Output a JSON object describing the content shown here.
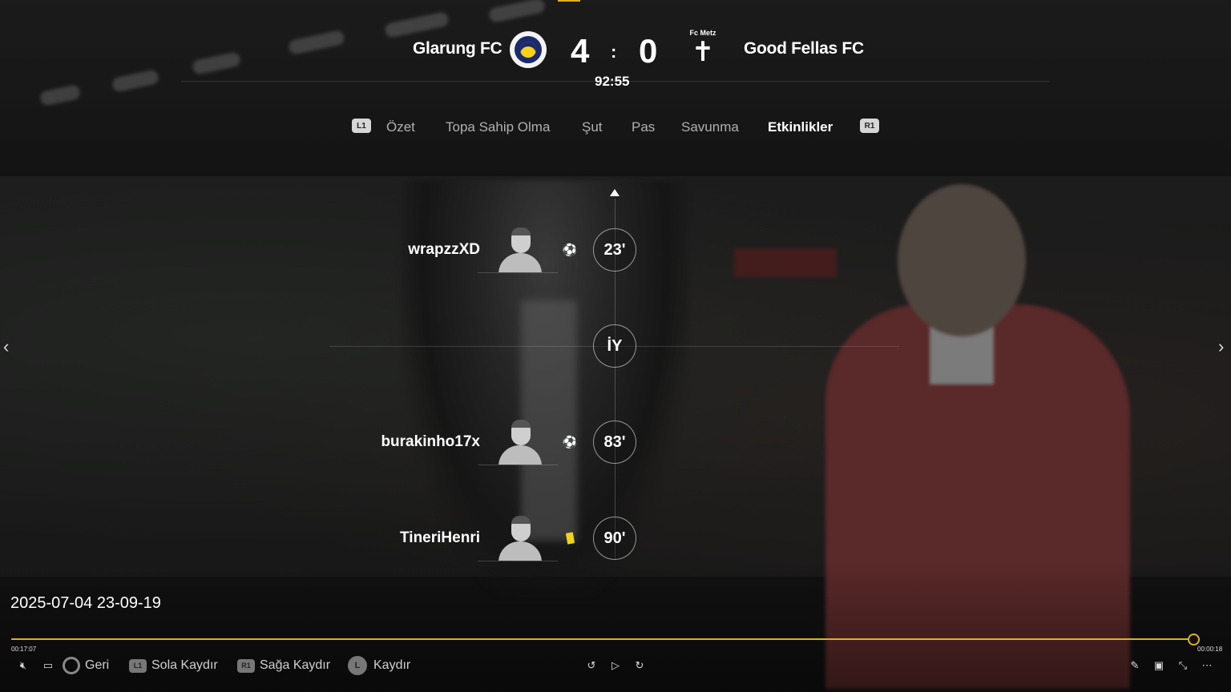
{
  "match": {
    "home_team": "Glarung FC",
    "away_team": "Good Fellas  FC",
    "home_score": "4",
    "away_score": "0",
    "separator": ":",
    "clock": "92:55",
    "away_crest_label": "Fc Metz",
    "away_crest_icon": "cross-crest-icon",
    "home_crest_icon": "club-crest-icon"
  },
  "tabs": {
    "left_button": "L1",
    "right_button": "R1",
    "items": [
      {
        "label": "Özet"
      },
      {
        "label": "Topa Sahip Olma"
      },
      {
        "label": "Şut"
      },
      {
        "label": "Pas"
      },
      {
        "label": "Savunma"
      },
      {
        "label": "Etkinlikler"
      }
    ],
    "active": "Etkinlikler"
  },
  "timeline": {
    "events": [
      {
        "player": "wrapzzXD",
        "minute": "23'",
        "icon": "goal-ball-icon"
      },
      {
        "player": "burakinho17x",
        "minute": "83'",
        "icon": "goal-ball-icon"
      },
      {
        "player": "TineriHenri",
        "minute": "90'",
        "icon": "yellow-card-icon"
      }
    ],
    "half_time_label": "İY"
  },
  "recording": {
    "timestamp": "2025-07-04 23-09-19",
    "elapsed": "00:17:07",
    "remaining": "00:00:18",
    "progress_fraction": 0.996
  },
  "controls": {
    "back_label": "Geri",
    "left_label": "Sola Kaydır",
    "right_label": "Sağa Kaydır",
    "scroll_label": "Kaydır",
    "l1": "L1",
    "r1": "R1",
    "l": "L"
  },
  "colors": {
    "accent": "#e0b020",
    "yellow_card": "#f2d21a"
  }
}
